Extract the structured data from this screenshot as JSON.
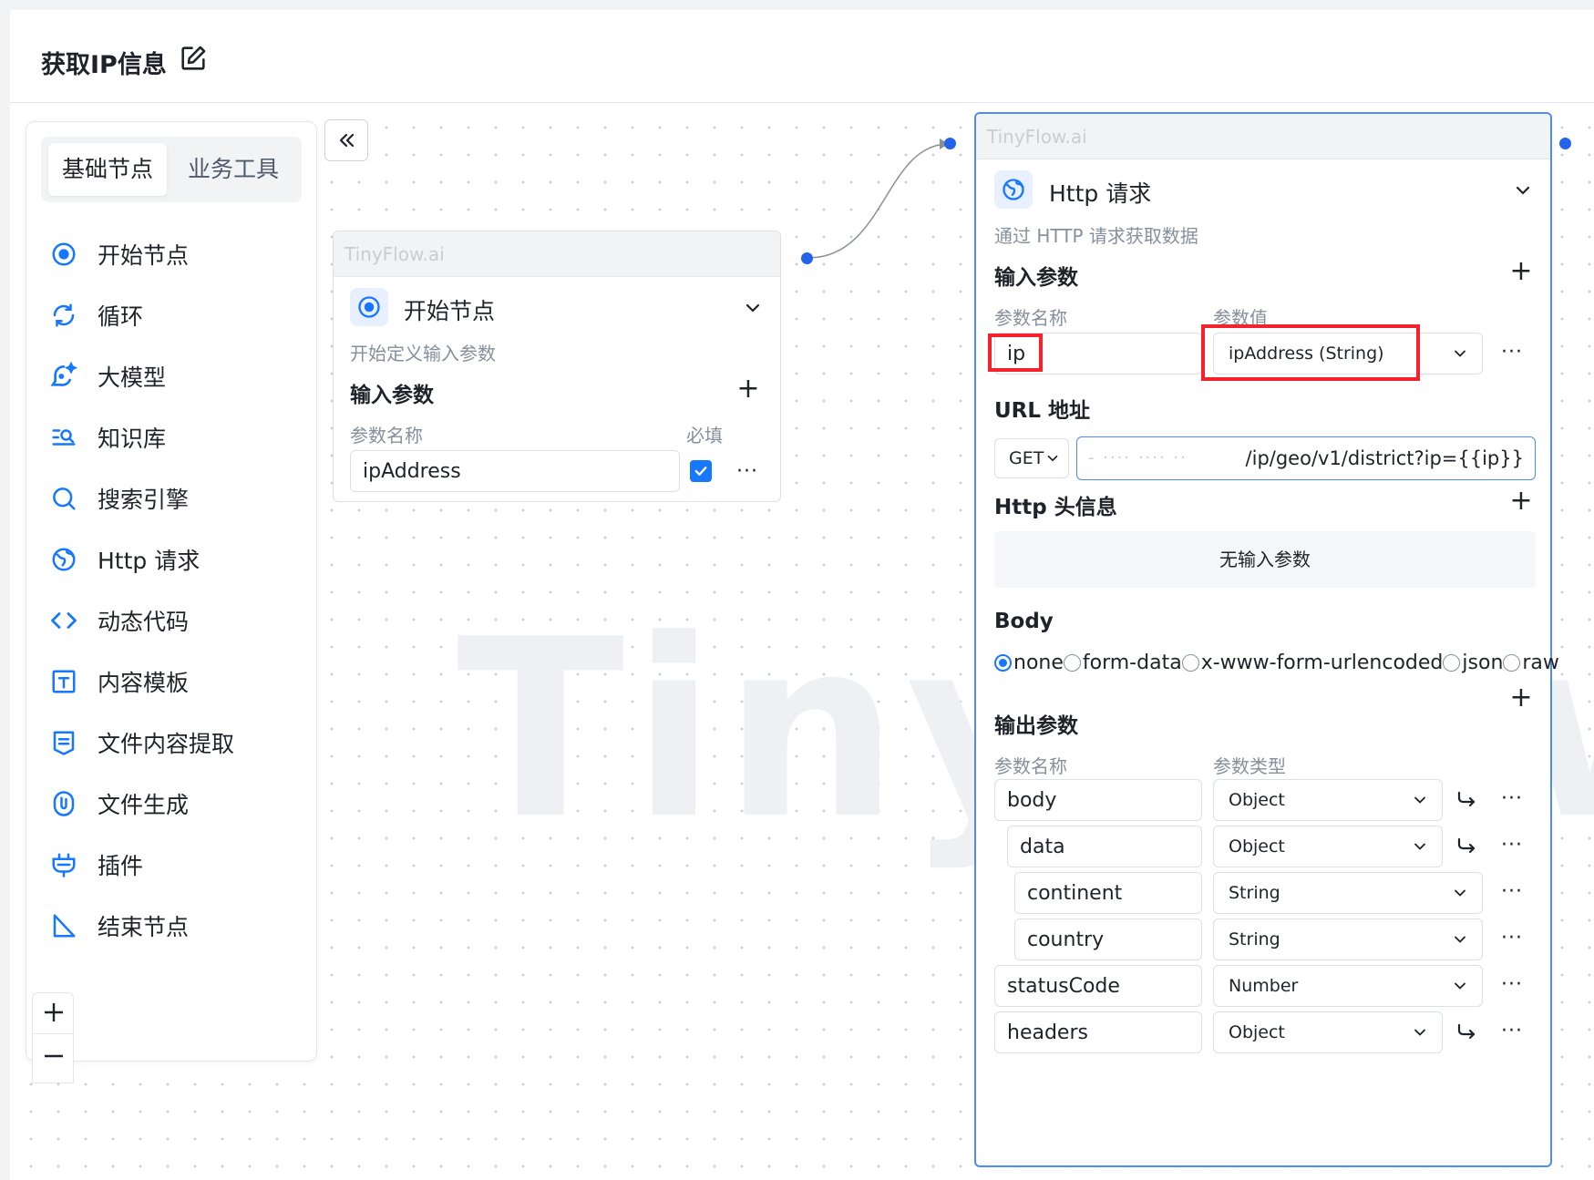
{
  "header": {
    "title": "获取IP信息"
  },
  "sidebar": {
    "tabs": [
      {
        "label": "基础节点"
      },
      {
        "label": "业务工具"
      }
    ],
    "items": [
      {
        "label": "开始节点",
        "icon": "start-icon"
      },
      {
        "label": "循环",
        "icon": "loop-icon"
      },
      {
        "label": "大模型",
        "icon": "llm-icon"
      },
      {
        "label": "知识库",
        "icon": "knowledge-icon"
      },
      {
        "label": "搜索引擎",
        "icon": "search-icon"
      },
      {
        "label": "Http 请求",
        "icon": "globe-icon"
      },
      {
        "label": "动态代码",
        "icon": "code-icon"
      },
      {
        "label": "内容模板",
        "icon": "template-icon"
      },
      {
        "label": "文件内容提取",
        "icon": "file-extract-icon"
      },
      {
        "label": "文件生成",
        "icon": "file-generate-icon"
      },
      {
        "label": "插件",
        "icon": "plugin-icon"
      },
      {
        "label": "结束节点",
        "icon": "end-icon"
      }
    ]
  },
  "canvas": {
    "watermark": "TinyFlow.ai"
  },
  "start_node": {
    "brand": "TinyFlow.ai",
    "title": "开始节点",
    "desc": "开始定义输入参数",
    "inputs_title": "输入参数",
    "col_name": "参数名称",
    "col_required": "必填",
    "param_value": "ipAddress"
  },
  "http_node": {
    "brand": "TinyFlow.ai",
    "title": "Http 请求",
    "desc": "通过 HTTP 请求获取数据",
    "inputs_title": "输入参数",
    "col_name": "参数名称",
    "col_value": "参数值",
    "input_param": {
      "name": "ip",
      "value": "ipAddress (String)"
    },
    "url_title": "URL 地址",
    "method": "GET",
    "url_value": "/ip/geo/v1/district?ip={{ip}}",
    "headers_title": "Http 头信息",
    "headers_empty": "无输入参数",
    "body_title": "Body",
    "body_options": [
      "none",
      "form-data",
      "x-www-form-urlencoded",
      "json",
      "raw"
    ],
    "body_selected": "none",
    "outputs_title": "输出参数",
    "out_col_name": "参数名称",
    "out_col_type": "参数类型",
    "outputs": [
      {
        "name": "body",
        "type": "Object",
        "level": 0,
        "has_child_link": true
      },
      {
        "name": "data",
        "type": "Object",
        "level": 1,
        "has_child_link": true
      },
      {
        "name": "continent",
        "type": "String",
        "level": 2,
        "has_child_link": false
      },
      {
        "name": "country",
        "type": "String",
        "level": 2,
        "has_child_link": false
      },
      {
        "name": "statusCode",
        "type": "Number",
        "level": 0,
        "has_child_link": false
      },
      {
        "name": "headers",
        "type": "Object",
        "level": 0,
        "has_child_link": true
      }
    ]
  },
  "colors": {
    "accent": "#1677ff",
    "annotation": "#f5222d",
    "port": "#2563eb"
  }
}
